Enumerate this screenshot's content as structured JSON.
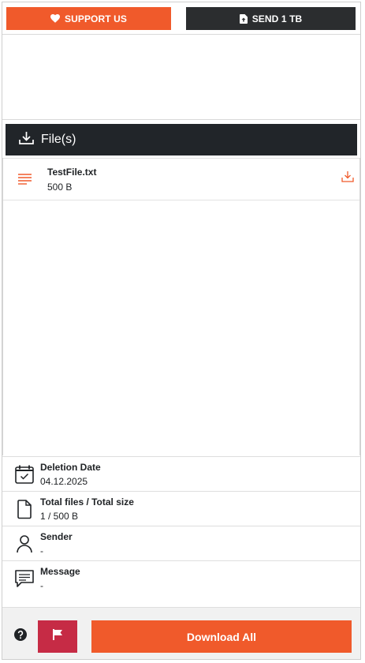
{
  "top_buttons": {
    "support_label": "SUPPORT US",
    "support_icon": "heart-icon",
    "send_label": "SEND 1 TB",
    "send_icon": "file-upload-icon"
  },
  "files_section": {
    "title": "File(s)",
    "icon": "download-icon",
    "files": [
      {
        "name": "TestFile.txt",
        "size": "500 B",
        "icon": "text-file-icon",
        "action_icon": "download-icon"
      }
    ]
  },
  "info": {
    "deletion": {
      "title": "Deletion Date",
      "value": "04.12.2025",
      "icon": "calendar-icon"
    },
    "totals": {
      "title": "Total files / Total size",
      "value": "1 / 500 B",
      "icon": "file-icon"
    },
    "sender": {
      "title": "Sender",
      "value": "-",
      "icon": "person-icon"
    },
    "message": {
      "title": "Message",
      "value": "-",
      "icon": "chat-icon"
    }
  },
  "footer": {
    "help_icon": "question-icon",
    "flag_icon": "flag-icon",
    "download_all_label": "Download All"
  },
  "colors": {
    "accent": "#f05a2b",
    "dark": "#212529",
    "report": "#c62b45"
  }
}
